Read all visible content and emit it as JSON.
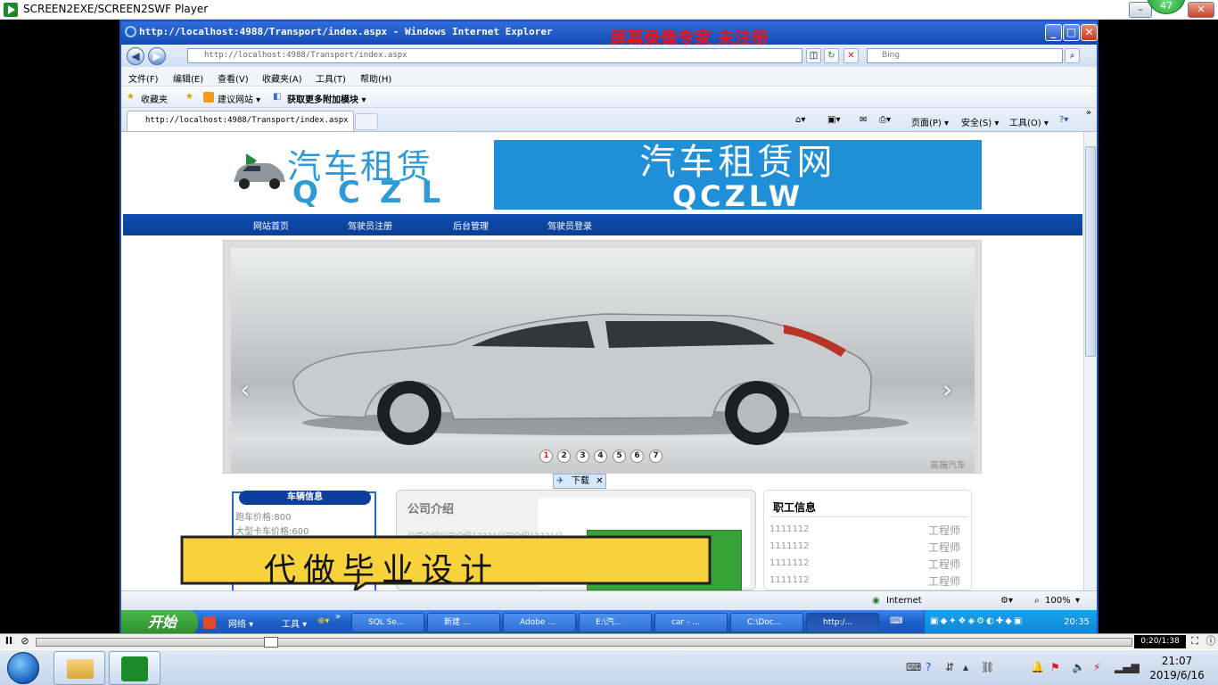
{
  "player": {
    "title": "SCREEN2EXE/SCREEN2SWF Player",
    "badge": "47",
    "time": "0:20/1:38",
    "play_pause": "II"
  },
  "ie": {
    "title": "http://localhost:4988/Transport/index.aspx - Windows Internet Explorer",
    "watermark": "屏幕录像专家 未注册",
    "address": "http://localhost:4988/Transport/index.aspx",
    "search_placeholder": "Bing",
    "menu": [
      "文件(F)",
      "编辑(E)",
      "查看(V)",
      "收藏夹(A)",
      "工具(T)",
      "帮助(H)"
    ],
    "favorites_label": "收藏夹",
    "fav_links": [
      "建议网站 ▾",
      "获取更多附加模块 ▾"
    ],
    "tab_title": "http://localhost:4988/Transport/index.aspx",
    "commands": [
      "页面(P) ▾",
      "安全(S) ▾",
      "工具(O) ▾"
    ],
    "status_zone": "Internet",
    "zoom": "100%"
  },
  "site": {
    "logo_zh": "汽车租赁",
    "logo_en": "QCZL",
    "banner_zh": "汽车租赁网",
    "banner_en": "QCZLW",
    "nav": [
      "网站首页",
      "驾驶员注册",
      "后台管理",
      "驾驶员登录"
    ],
    "slider_dots": [
      "1",
      "2",
      "3",
      "4",
      "5",
      "6",
      "7"
    ],
    "slider_prev": "‹",
    "slider_next": "›",
    "slide_watermark": "高端汽车",
    "download_label": "下载",
    "vehicle_title": "车辆信息",
    "vehicles": [
      "跑车价格:800",
      "大型卡车价格:600"
    ],
    "company_title": "公司介绍",
    "company_text": "公司介绍公司介绍12321公司介绍12321公",
    "staff_title": "职工信息",
    "staff": [
      {
        "id": "1111112",
        "role": "工程师"
      },
      {
        "id": "1111112",
        "role": "工程师"
      },
      {
        "id": "1111112",
        "role": "工程师"
      },
      {
        "id": "1111112",
        "role": "工程师"
      }
    ],
    "ad_text": "代做毕业设计"
  },
  "xp_taskbar": {
    "start": "开始",
    "quick": [
      "网络 ▾",
      "工具 ▾"
    ],
    "tasks": [
      "SQL Se...",
      "新建 ...",
      "Adobe ...",
      "E:\\汽...",
      "car - ...",
      "C:\\Doc...",
      "http:/..."
    ],
    "clock": "20:35"
  },
  "w7_taskbar": {
    "time": "21:07",
    "date": "2019/6/16"
  }
}
